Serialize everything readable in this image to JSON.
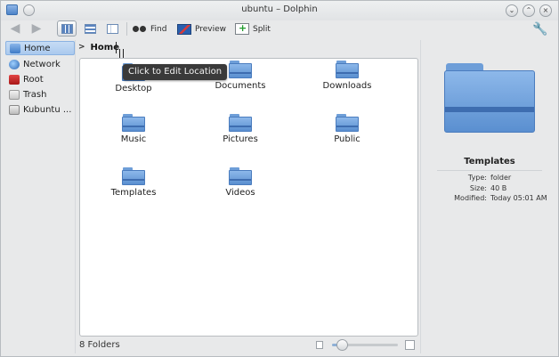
{
  "window": {
    "title": "ubuntu – Dolphin"
  },
  "toolbar": {
    "find_label": "Find",
    "preview_label": "Preview",
    "split_label": "Split"
  },
  "places": [
    {
      "label": "Home",
      "icon": "home-folder-icon"
    },
    {
      "label": "Network",
      "icon": "network-icon"
    },
    {
      "label": "Root",
      "icon": "root-drive-icon"
    },
    {
      "label": "Trash",
      "icon": "trash-icon"
    },
    {
      "label": "Kubuntu ...",
      "icon": "drive-icon"
    }
  ],
  "breadcrumb": {
    "separator": ">",
    "current": "Home"
  },
  "tooltip": "Click to Edit Location",
  "folders": [
    {
      "name": "Desktop"
    },
    {
      "name": "Documents"
    },
    {
      "name": "Downloads"
    },
    {
      "name": "Music"
    },
    {
      "name": "Pictures"
    },
    {
      "name": "Public"
    },
    {
      "name": "Templates"
    },
    {
      "name": "Videos"
    }
  ],
  "info": {
    "name": "Templates",
    "type_key": "Type:",
    "type_val": "folder",
    "size_key": "Size:",
    "size_val": "40 B",
    "modified_key": "Modified:",
    "modified_val": "Today 05:01 AM"
  },
  "status": {
    "text": "8 Folders",
    "zoom_level": 0.15
  },
  "colors": {
    "folder": "#5a8fd0",
    "selection": "#aac9ee",
    "tooltip_bg": "#3a3a3a"
  }
}
